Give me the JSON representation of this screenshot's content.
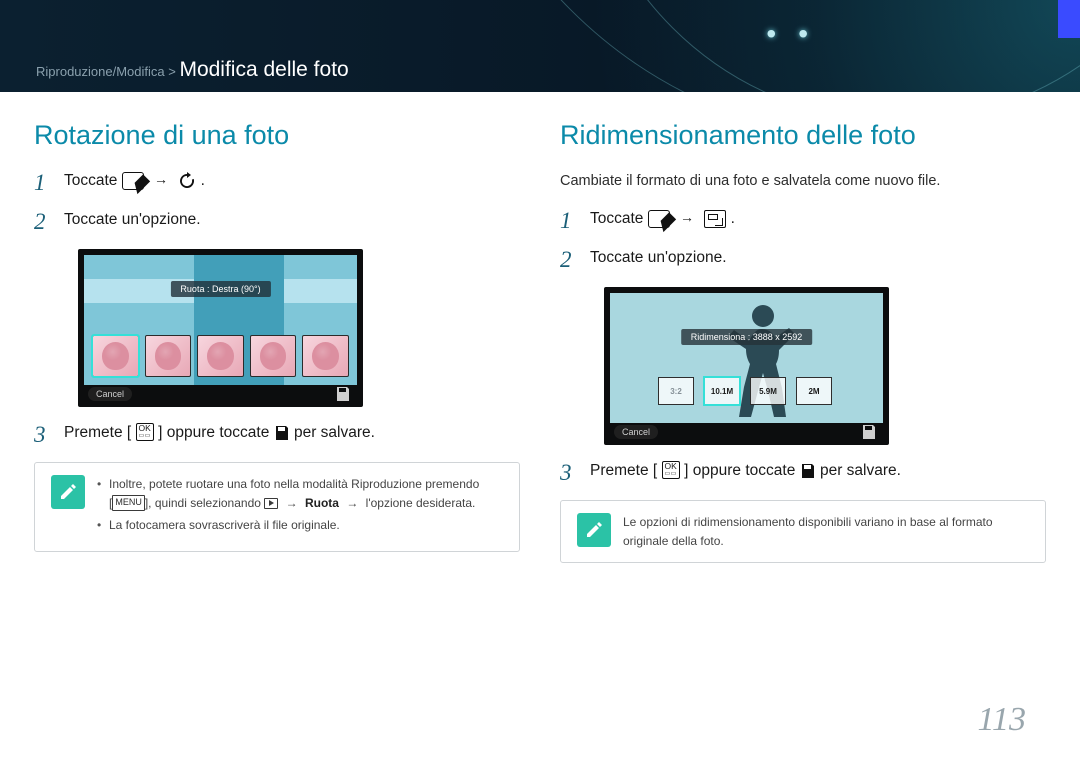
{
  "breadcrumb": {
    "path": "Riproduzione/Modifica >",
    "title": "Modifica delle foto"
  },
  "left": {
    "heading": "Rotazione di una foto",
    "step1_a": "Toccate",
    "step1_b": ".",
    "step2": "Toccate un'opzione.",
    "shot_label": "Ruota : Destra (90°)",
    "cancel": "Cancel",
    "step3_a": "Premete [",
    "step3_b": "] oppure toccate",
    "step3_c": "per salvare.",
    "note_line1_a": "Inoltre, potete ruotare una foto nella modalità Riproduzione premendo",
    "note_line1_b": "[",
    "note_line1_c": "], quindi selezionando",
    "note_line1_d": "Ruota",
    "note_line1_e": "l'opzione desiderata.",
    "note_line2": "La fotocamera sovrascriverà il file originale."
  },
  "right": {
    "heading": "Ridimensionamento delle foto",
    "intro": "Cambiate il formato di una foto e salvatela come nuovo file.",
    "step1_a": "Toccate",
    "step1_b": ".",
    "step2": "Toccate un'opzione.",
    "shot_label": "Ridimensiona : 3888 x 2592",
    "size_options": [
      "3:2",
      "10.1M",
      "5.9M",
      "2M"
    ],
    "cancel": "Cancel",
    "step3_a": "Premete [",
    "step3_b": "] oppure toccate",
    "step3_c": "per salvare.",
    "note": "Le opzioni di ridimensionamento disponibili variano in base al formato originale della foto."
  },
  "ok_label_top": "OK",
  "menu_label": "MENU",
  "page_number": "113"
}
